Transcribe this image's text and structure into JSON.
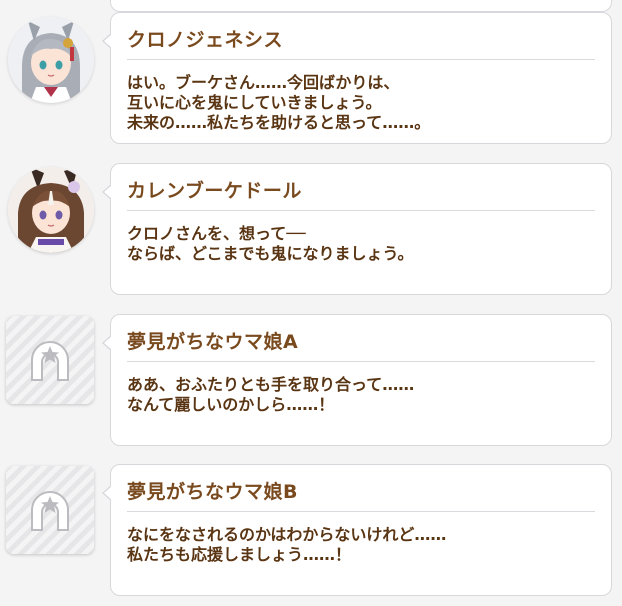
{
  "messages": [
    {
      "speaker": "クロノジェネシス",
      "text": "はい。ブーケさん……今回ばかりは、\n互いに心を鬼にしていきましょう。\n未来の……私たちを助けると思って……。",
      "avatar": "chrono-genesis-portrait"
    },
    {
      "speaker": "カレンブーケドール",
      "text": "クロノさんを、想って──\nならば、どこまでも鬼になりましょう。",
      "avatar": "curren-bouquetdor-portrait"
    },
    {
      "speaker": "夢見がちなウマ娘A",
      "text": "ああ、おふたりとも手を取り合って……\nなんて麗しいのかしら……！",
      "avatar": "horseshoe-placeholder"
    },
    {
      "speaker": "夢見がちなウマ娘B",
      "text": "なにをなされるのかはわからないけれど……\n私たちも応援しましょう……！",
      "avatar": "horseshoe-placeholder"
    }
  ],
  "colors": {
    "name_text": "#7a4a1f",
    "message_text": "#5a3513",
    "background": "#f4f4f5"
  }
}
